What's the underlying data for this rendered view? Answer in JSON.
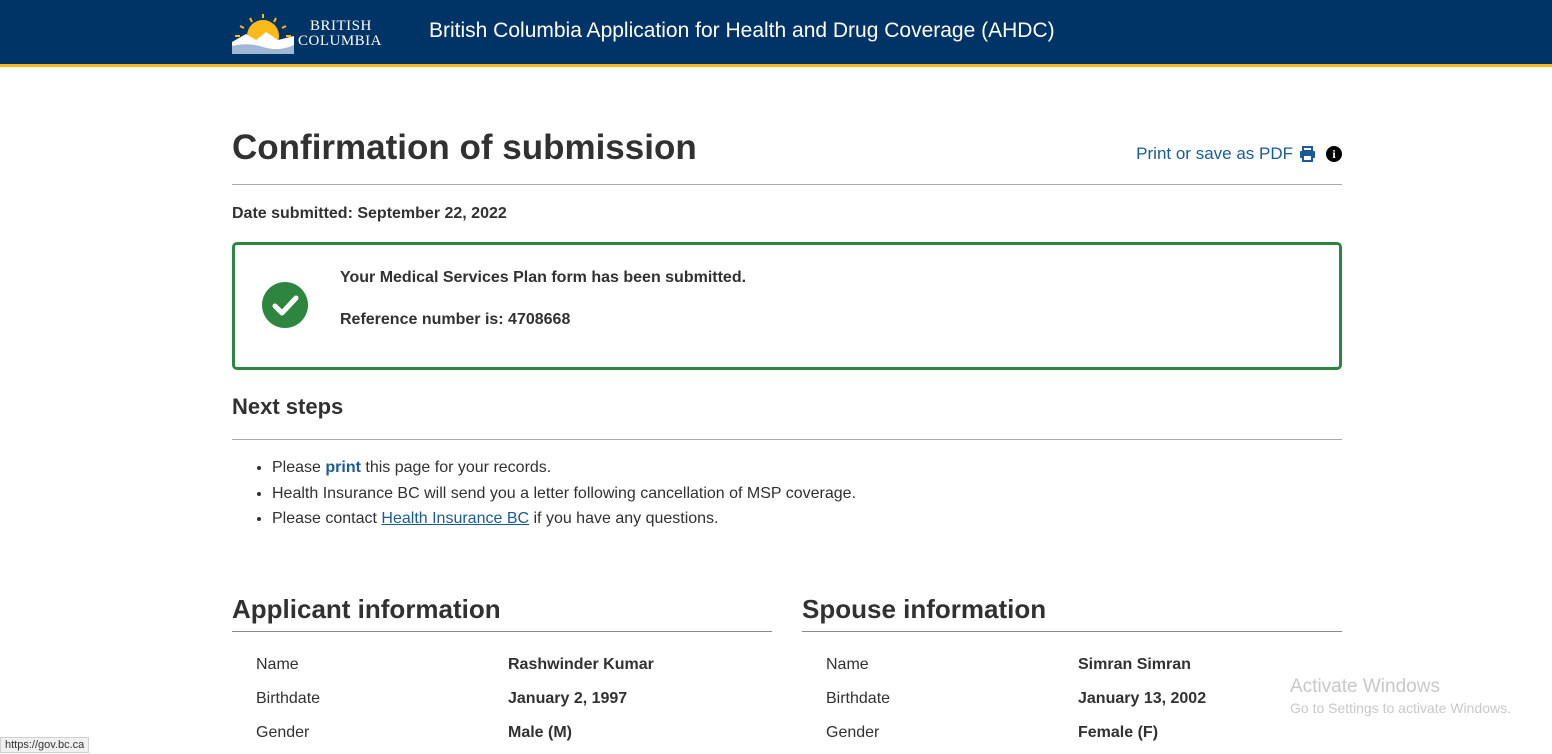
{
  "header": {
    "logo_line1": "BRITISH",
    "logo_line2": "COLUMBIA",
    "app_title": "British Columbia Application for Health and Drug Coverage (AHDC)"
  },
  "page": {
    "title": "Confirmation of submission",
    "print_link": "Print or save as PDF",
    "date_submitted": "Date submitted: September 22, 2022"
  },
  "success": {
    "message": "Your Medical Services Plan form has been submitted.",
    "reference": "Reference number is: 4708668"
  },
  "next_steps": {
    "heading": "Next steps",
    "item1_pre": "Please ",
    "item1_link": "print",
    "item1_post": " this page for your records.",
    "item2": "Health Insurance BC will send you a letter following cancellation of MSP coverage.",
    "item3_pre": "Please contact ",
    "item3_link": "Health Insurance BC",
    "item3_post": " if you have any questions."
  },
  "applicant": {
    "heading": "Applicant information",
    "rows": [
      {
        "label": "Name",
        "value": "Rashwinder Kumar"
      },
      {
        "label": "Birthdate",
        "value": "January 2, 1997"
      },
      {
        "label": "Gender",
        "value": "Male (M)"
      }
    ]
  },
  "spouse": {
    "heading": "Spouse information",
    "rows": [
      {
        "label": "Name",
        "value": "Simran Simran"
      },
      {
        "label": "Birthdate",
        "value": "January 13, 2002"
      },
      {
        "label": "Gender",
        "value": "Female (F)"
      }
    ]
  },
  "os": {
    "watermark_title": "Activate Windows",
    "watermark_sub": "Go to Settings to activate Windows.",
    "status_url": "https://gov.bc.ca"
  },
  "colors": {
    "header_bg": "#003366",
    "header_accent": "#fcba19",
    "success": "#2e8540",
    "link": "#1a5a96"
  }
}
